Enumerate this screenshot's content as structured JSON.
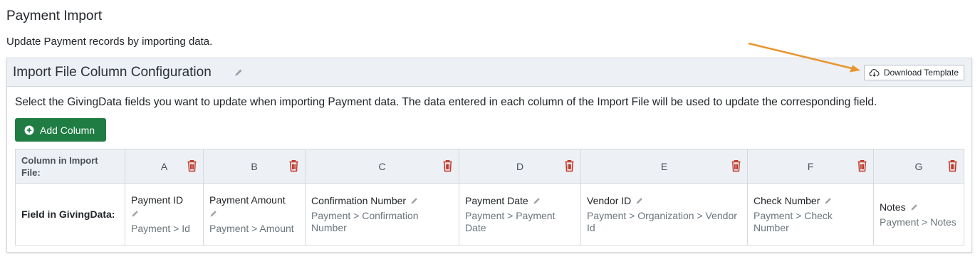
{
  "page": {
    "title": "Payment Import",
    "subtitle": "Update Payment records by importing data."
  },
  "card": {
    "title": "Import File Column Configuration",
    "download_label": "Download Template",
    "description": "Select the GivingData fields you want to update when importing Payment data. The data entered in each column of the Import File will be used to update the corresponding field.",
    "add_column_label": "Add Column"
  },
  "table": {
    "header_label": "Column in Import File:",
    "field_label": "Field in GivingData:",
    "columns": [
      {
        "letter": "A",
        "field": "Payment ID",
        "path": "Payment > Id"
      },
      {
        "letter": "B",
        "field": "Payment Amount",
        "path": "Payment > Amount"
      },
      {
        "letter": "C",
        "field": "Confirmation Number",
        "path": "Payment > Confirmation Number"
      },
      {
        "letter": "D",
        "field": "Payment Date",
        "path": "Payment > Payment Date"
      },
      {
        "letter": "E",
        "field": "Vendor ID",
        "path": "Payment > Organization > Vendor Id"
      },
      {
        "letter": "F",
        "field": "Check Number",
        "path": "Payment > Check Number"
      },
      {
        "letter": "G",
        "field": "Notes",
        "path": "Payment > Notes"
      }
    ]
  },
  "colors": {
    "accent_green": "#1f7d43",
    "trash_red": "#c0392b",
    "annotation_orange": "#e8962e",
    "header_bg": "#edf0f4"
  },
  "icons": {
    "download": "cloud-download-icon",
    "add": "plus-circle-icon",
    "delete": "trash-icon",
    "edit": "pencil-icon"
  }
}
